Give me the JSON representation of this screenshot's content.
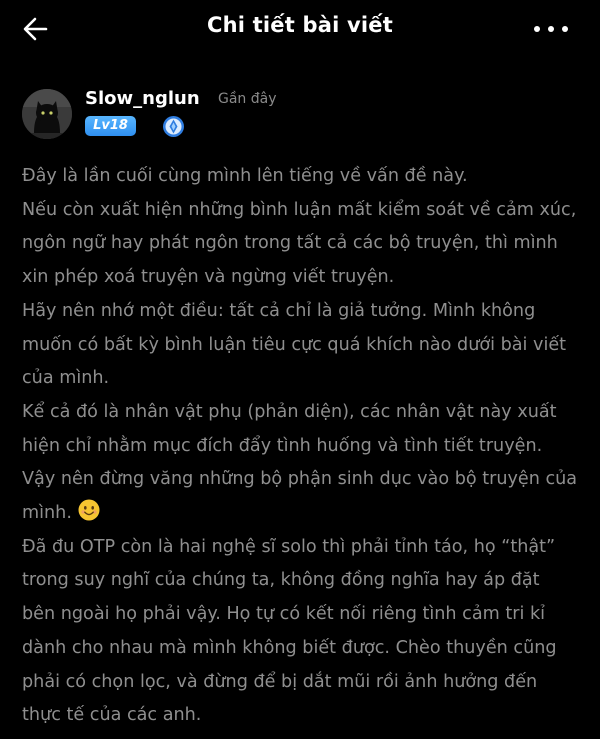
{
  "header": {
    "title": "Chi tiết bài viết",
    "back_icon": "arrow-left-icon",
    "more_icon": "more-horizontal-icon"
  },
  "post": {
    "author": {
      "name": "Slow_nglun",
      "time": "Gần đây",
      "level": "Lv18",
      "avatar": "black-cat-avatar",
      "rank_icon": "blue-rank-icon"
    },
    "paragraphs": [
      "Đây là lần cuối cùng mình lên tiếng về vấn đề này.",
      "Nếu còn xuất hiện những bình luận mất kiểm soát về cảm xúc, ngôn ngữ hay phát ngôn trong tất cả các bộ truyện, thì mình xin phép xoá truyện và ngừng viết truyện.",
      "Hãy nên nhớ một điều: tất cả chỉ là giả tưởng. Mình không muốn có bất kỳ bình luận tiêu cực quá khích nào dưới bài viết của mình.",
      "Kể cả đó là nhân vật phụ (phản diện), các nhân vật này xuất hiện chỉ nhằm mục đích đẩy tình huống và tình tiết truyện. Vậy nên đừng văng những bộ phận sinh dục vào bộ truyện của mình.",
      "Đã đu OTP còn là hai nghệ sĩ solo thì phải tỉnh táo, họ “thật” trong suy nghĩ của chúng ta, không đồng nghĩa hay áp đặt bên ngoài họ phải vậy. Họ tự có kết nối riêng tình cảm tri kỉ dành cho nhau mà mình không biết được. Chèo thuyền cũng phải có chọn lọc, và đừng để bị dắt mũi rồi ảnh hưởng đến thực tế của các anh."
    ],
    "emoji_icon": "smiling-face-emoji-icon"
  },
  "colors": {
    "background": "#000000",
    "title": "#ffffff",
    "body_text": "#8f8f8f",
    "level_badge": "#3a9cf5",
    "emoji": "#f7c531"
  }
}
